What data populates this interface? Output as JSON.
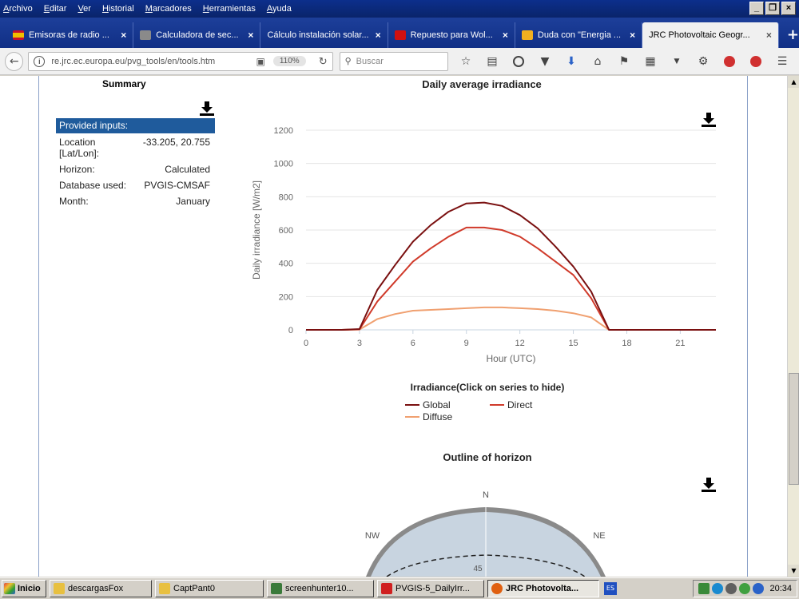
{
  "menubar": {
    "items": [
      "Archivo",
      "Editar",
      "Ver",
      "Historial",
      "Marcadores",
      "Herramientas",
      "Ayuda"
    ],
    "controls": [
      "_",
      "❐",
      "×"
    ]
  },
  "tabs": [
    {
      "label": "Emisoras de radio ...",
      "color": "#c8102e"
    },
    {
      "label": "Calculadora de sec...",
      "color": "#888888"
    },
    {
      "label": "Cálculo instalación solar...",
      "color": ""
    },
    {
      "label": "Repuesto para Wol...",
      "color": "#d01010"
    },
    {
      "label": "Duda con \"Energia ...",
      "color": "#f0b020"
    },
    {
      "label": "JRC Photovoltaic Geogr...",
      "color": "",
      "active": true
    }
  ],
  "navbar": {
    "url": "re.jrc.ec.europa.eu/pvg_tools/en/tools.htm",
    "zoom": "110%",
    "search_placeholder": "Buscar"
  },
  "summary": {
    "title": "Summary",
    "header": "Provided inputs:",
    "rows": [
      {
        "key": "Location [Lat/Lon]:",
        "value": "-33.205, 20.755"
      },
      {
        "key": "Horizon:",
        "value": "Calculated"
      },
      {
        "key": "Database used:",
        "value": "PVGIS-CMSAF"
      },
      {
        "key": "Month:",
        "value": "January"
      }
    ]
  },
  "chart_data": {
    "type": "line",
    "title": "Daily average irradiance",
    "xlabel": "Hour (UTC)",
    "ylabel": "Daily irradiance [W/m2]",
    "xlim": [
      0,
      23
    ],
    "ylim": [
      0,
      1200
    ],
    "xticks": [
      0,
      3,
      6,
      9,
      12,
      15,
      18,
      21
    ],
    "yticks": [
      0,
      200,
      400,
      600,
      800,
      1000,
      1200
    ],
    "grid": true,
    "x": [
      0,
      1,
      2,
      3,
      4,
      5,
      6,
      7,
      8,
      9,
      10,
      11,
      12,
      13,
      14,
      15,
      16,
      17,
      18,
      19,
      20,
      21,
      22,
      23
    ],
    "series": [
      {
        "name": "Global",
        "color": "#7a1010",
        "values": [
          0,
          0,
          0,
          5,
          240,
          390,
          530,
          630,
          710,
          760,
          765,
          745,
          690,
          610,
          500,
          380,
          230,
          0,
          0,
          0,
          0,
          0,
          0,
          0
        ]
      },
      {
        "name": "Direct",
        "color": "#d03a2a",
        "values": [
          0,
          0,
          0,
          3,
          170,
          290,
          410,
          490,
          560,
          615,
          615,
          600,
          560,
          490,
          410,
          330,
          190,
          0,
          0,
          0,
          0,
          0,
          0,
          0
        ]
      },
      {
        "name": "Diffuse",
        "color": "#f0a070",
        "values": [
          0,
          0,
          0,
          2,
          65,
          95,
          115,
          120,
          125,
          130,
          135,
          135,
          130,
          125,
          115,
          100,
          75,
          0,
          0,
          0,
          0,
          0,
          0,
          0
        ]
      }
    ],
    "legend_title": "Irradiance(Click on series to hide)",
    "legend_position": "bottom"
  },
  "horizon": {
    "title": "Outline of horizon",
    "labels": {
      "n": "N",
      "nw": "NW",
      "ne": "NE",
      "ring": "45"
    }
  },
  "taskbar": {
    "start": "Inicio",
    "buttons": [
      {
        "label": "descargasFox",
        "color": "#e8c040"
      },
      {
        "label": "CaptPant0",
        "color": "#e8c040"
      },
      {
        "label": "screenhunter10...",
        "color": "#3a7a3a"
      },
      {
        "label": "PVGIS-5_DailyIrr...",
        "color": "#d02020"
      },
      {
        "label": "JRC Photovolta...",
        "color": "#e06010",
        "active": true
      }
    ],
    "lang": "ES",
    "time": "20:34"
  }
}
